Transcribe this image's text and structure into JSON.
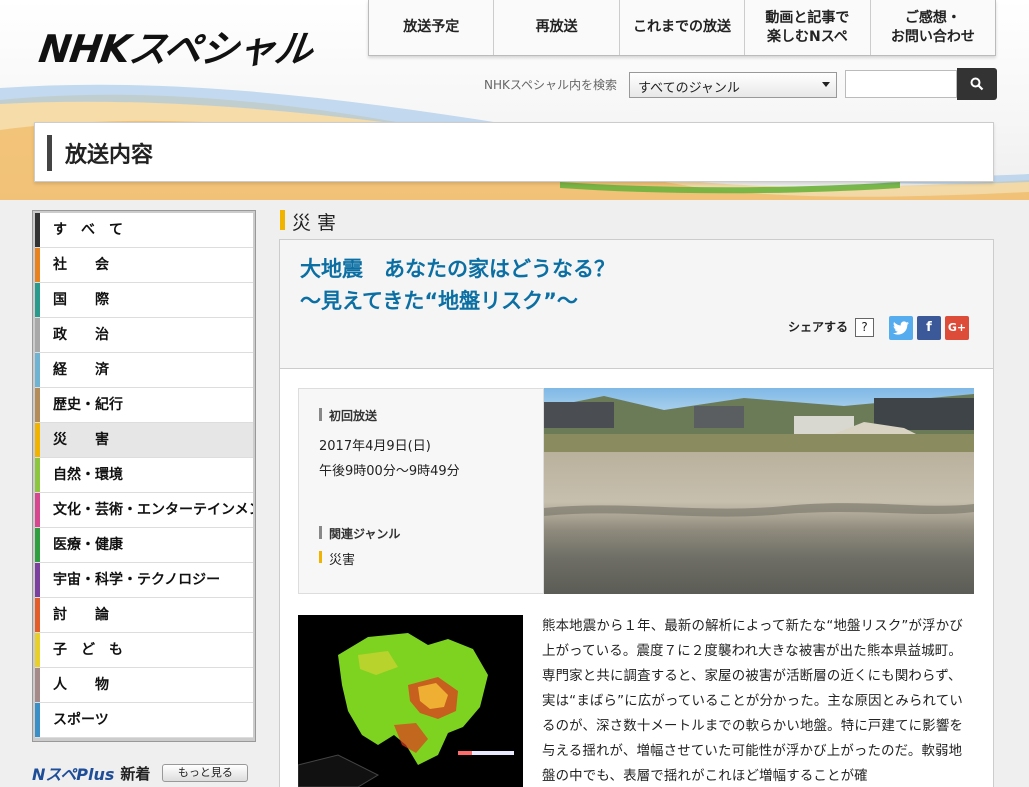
{
  "header": {
    "logo_text": "NHKスペシャル",
    "nav": [
      {
        "label": "放送予定"
      },
      {
        "label": "再放送"
      },
      {
        "label": "これまでの放送"
      },
      {
        "label": "動画と記事で\n楽しむNスペ"
      },
      {
        "label": "ご感想・\nお問い合わせ"
      }
    ],
    "search": {
      "label": "NHKスペシャル内を検索",
      "selected_genre": "すべてのジャンル",
      "placeholder": "",
      "button_icon": "search-icon"
    }
  },
  "page": {
    "title": "放送内容"
  },
  "sidebar": {
    "items": [
      {
        "label": "す　べ　て",
        "color": "#333333"
      },
      {
        "label": "社　　会",
        "color": "#e8821e"
      },
      {
        "label": "国　　際",
        "color": "#2a9a8c"
      },
      {
        "label": "政　　治",
        "color": "#a8a8a8"
      },
      {
        "label": "経　　済",
        "color": "#6fb3d2"
      },
      {
        "label": "歴史・紀行",
        "color": "#b38c5a"
      },
      {
        "label": "災　　害",
        "color": "#f0b400",
        "active": true
      },
      {
        "label": "自然・環境",
        "color": "#8cc63f"
      },
      {
        "label": "文化・芸術・エンターテインメント",
        "color": "#d6478f"
      },
      {
        "label": "医療・健康",
        "color": "#2e9e3e"
      },
      {
        "label": "宇宙・科学・テクノロジー",
        "color": "#7b3f9e"
      },
      {
        "label": "討　　論",
        "color": "#e35d2b"
      },
      {
        "label": "子　ど　も",
        "color": "#e8cf2a"
      },
      {
        "label": "人　　物",
        "color": "#a58a8a"
      },
      {
        "label": "スポーツ",
        "color": "#3a8fc6"
      }
    ],
    "nsp_plus": {
      "logo": "NスペPlus",
      "label": "新着",
      "more": "もっと見る"
    }
  },
  "main": {
    "category": "災害",
    "title": "大地震　あなたの家はどうなる？\n～見えてきた“地盤リスク”～",
    "share": {
      "label": "シェアする",
      "help": "?",
      "buttons": [
        {
          "name": "twitter",
          "icon": "twitter-bird-icon",
          "color": "#55acee"
        },
        {
          "name": "facebook",
          "icon": "facebook-f-icon",
          "color": "#3b5998"
        },
        {
          "name": "google-plus",
          "icon": "google-plus-icon",
          "color": "#dd4b39"
        }
      ]
    },
    "broadcast": {
      "first_label": "初回放送",
      "date": "2017年4月9日(日)",
      "time": "午後9時00分～9時49分",
      "genre_label": "関連ジャンル",
      "genre": "災害"
    },
    "body": "熊本地震から１年、最新の解析によって新たな“地盤リスク”が浮かび上がっている。震度７に２度襲われ大きな被害が出た熊本県益城町。専門家と共に調査すると、家屋の被害が活断層の近くにも関わらず、実は“まばら”に広がっていることが分かった。主な原因とみられているのが、深さ数十メートルまでの軟らかい地盤。特に戸建てに影響を与える揺れが、増幅させていた可能性が浮かび上がったのだ。軟弱地盤の中でも、表層で揺れがこれほど増幅することが確"
  }
}
